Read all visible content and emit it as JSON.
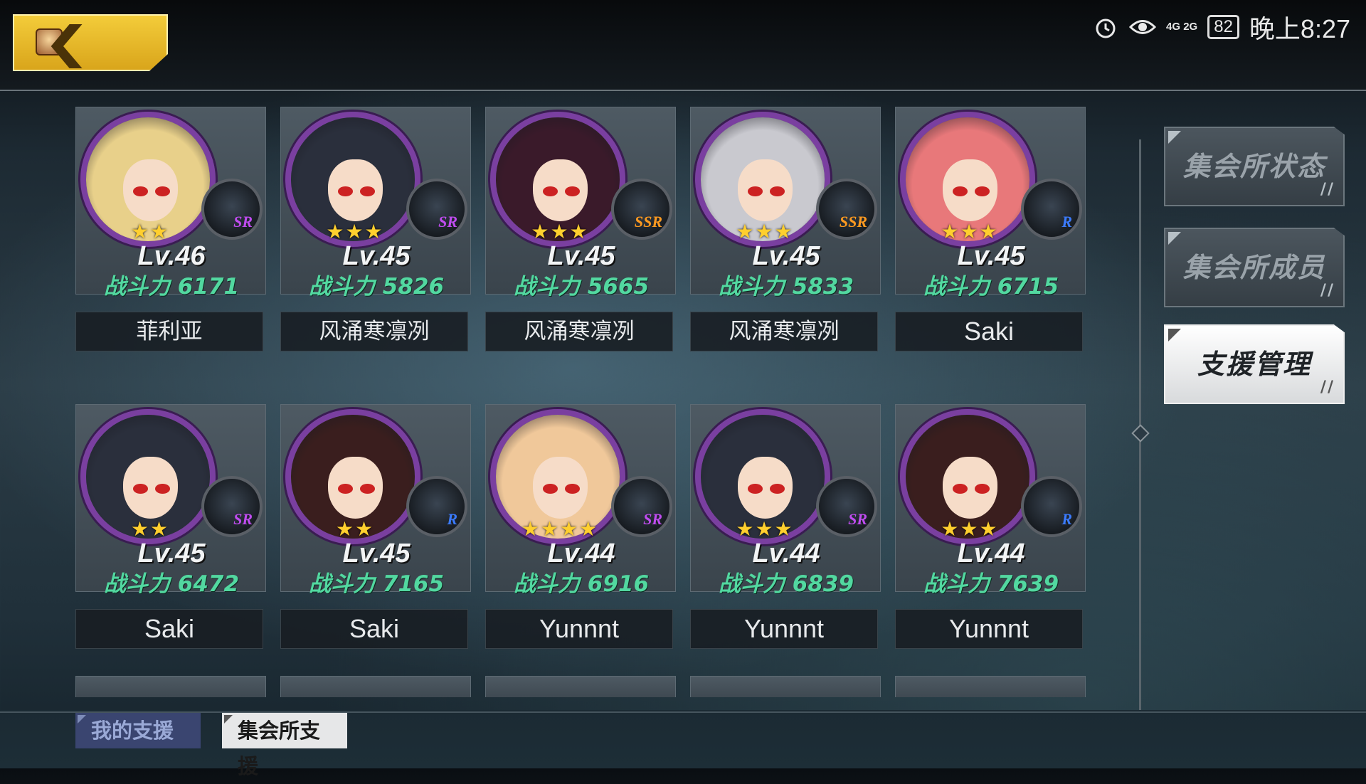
{
  "status_bar": {
    "alarm_icon": "alarm-icon",
    "eye_icon": "eye-icon",
    "network": "4G 2G",
    "battery": "82",
    "time": "晚上8:27"
  },
  "header": {
    "back_icon": "back-arrow-icon"
  },
  "power_label": "战斗力",
  "cards": [
    {
      "level": "Lv.46",
      "power": "6171",
      "name": "菲利亚",
      "rarity": "SR",
      "stars": "★★",
      "hair": "#e8d08a",
      "frame_color": "#7a3fa0",
      "rarity_color": "#c04cf0"
    },
    {
      "level": "Lv.45",
      "power": "5826",
      "name": "风涌寒凛冽",
      "rarity": "SR",
      "stars": "★★★",
      "hair": "#2a2f3c",
      "frame_color": "#7a3fa0",
      "rarity_color": "#c04cf0"
    },
    {
      "level": "Lv.45",
      "power": "5665",
      "name": "风涌寒凛冽",
      "rarity": "SSR",
      "stars": "★★★",
      "hair": "#3a1a2a",
      "frame_color": "#7a3fa0",
      "rarity_color": "#ff9a20"
    },
    {
      "level": "Lv.45",
      "power": "5833",
      "name": "风涌寒凛冽",
      "rarity": "SSR",
      "stars": "★★★",
      "hair": "#c9c9cf",
      "frame_color": "#7a3fa0",
      "rarity_color": "#ff9a20"
    },
    {
      "level": "Lv.45",
      "power": "6715",
      "name": "Saki",
      "rarity": "R",
      "stars": "★★★",
      "hair": "#e8787a",
      "frame_color": "#7a3fa0",
      "rarity_color": "#3b7bff"
    },
    {
      "level": "Lv.45",
      "power": "6472",
      "name": "Saki",
      "rarity": "SR",
      "stars": "★★",
      "hair": "#2a2f3c",
      "frame_color": "#7a3fa0",
      "rarity_color": "#c04cf0"
    },
    {
      "level": "Lv.45",
      "power": "7165",
      "name": "Saki",
      "rarity": "R",
      "stars": "★★",
      "hair": "#3a1e1e",
      "frame_color": "#7a3fa0",
      "rarity_color": "#3b7bff"
    },
    {
      "level": "Lv.44",
      "power": "6916",
      "name": "Yunnnt",
      "rarity": "SR",
      "stars": "★★★★",
      "hair": "#f0c89a",
      "frame_color": "#7a3fa0",
      "rarity_color": "#c04cf0"
    },
    {
      "level": "Lv.44",
      "power": "6839",
      "name": "Yunnnt",
      "rarity": "SR",
      "stars": "★★★",
      "hair": "#2a2f3c",
      "frame_color": "#7a3fa0",
      "rarity_color": "#c04cf0"
    },
    {
      "level": "Lv.44",
      "power": "7639",
      "name": "Yunnnt",
      "rarity": "R",
      "stars": "★★★",
      "hair": "#3a1e1e",
      "frame_color": "#7a3fa0",
      "rarity_color": "#3b7bff"
    }
  ],
  "side_menu": {
    "items": [
      {
        "label": "集会所状态",
        "active": false
      },
      {
        "label": "集会所成员",
        "active": false
      },
      {
        "label": "支援管理",
        "active": true
      }
    ]
  },
  "bottom_tabs": {
    "items": [
      {
        "label": "我的支援",
        "active": false
      },
      {
        "label": "集会所支援",
        "active": true
      }
    ]
  }
}
